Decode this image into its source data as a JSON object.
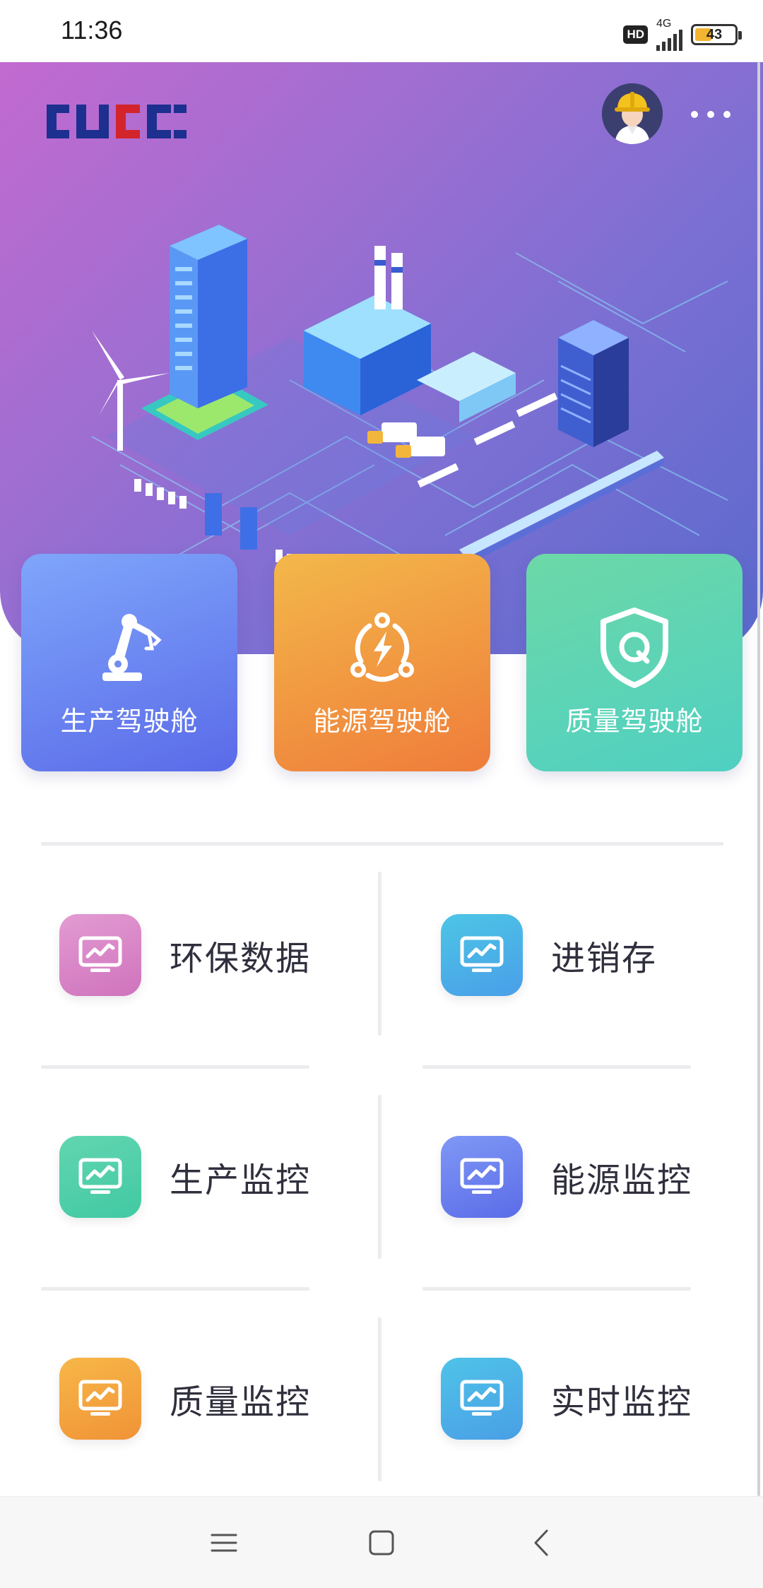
{
  "status_bar": {
    "time": "11:36",
    "hd": "HD",
    "network": "4G",
    "battery": "43",
    "battery_level": 0.43
  },
  "header": {
    "logo_text": "CUCC",
    "avatar_icon": "worker-helmet-avatar",
    "more_icon": "more-dots-icon"
  },
  "cockpits": [
    {
      "label": "生产驾驶舱",
      "icon": "robot-arm-icon",
      "colors": [
        "#7fa6fb",
        "#5a6ae8"
      ]
    },
    {
      "label": "能源驾驶舱",
      "icon": "energy-lightning-icon",
      "colors": [
        "#f3b84a",
        "#ef7c3a"
      ]
    },
    {
      "label": "质量驾驶舱",
      "icon": "quality-shield-icon",
      "colors": [
        "#6dd8a7",
        "#4fd0c2"
      ]
    }
  ],
  "menu": [
    {
      "label": "环保数据",
      "icon": "monitor-chart-icon",
      "colors": [
        "#e39bd2",
        "#cf73bd"
      ]
    },
    {
      "label": "进销存",
      "icon": "monitor-chart-icon",
      "colors": [
        "#4cc6e6",
        "#4a9ee8"
      ]
    },
    {
      "label": "生产监控",
      "icon": "monitor-chart-icon",
      "colors": [
        "#62d6b0",
        "#41c9a3"
      ]
    },
    {
      "label": "能源监控",
      "icon": "monitor-chart-icon",
      "colors": [
        "#7f98f5",
        "#5b6ce8"
      ]
    },
    {
      "label": "质量监控",
      "icon": "monitor-chart-icon",
      "colors": [
        "#f7b748",
        "#f09337"
      ]
    },
    {
      "label": "实时监控",
      "icon": "monitor-chart-icon",
      "colors": [
        "#4fc3e8",
        "#4a9fe6"
      ]
    }
  ],
  "nav": {
    "menu_icon": "hamburger-icon",
    "home_icon": "home-square-icon",
    "back_icon": "back-chevron-icon"
  }
}
